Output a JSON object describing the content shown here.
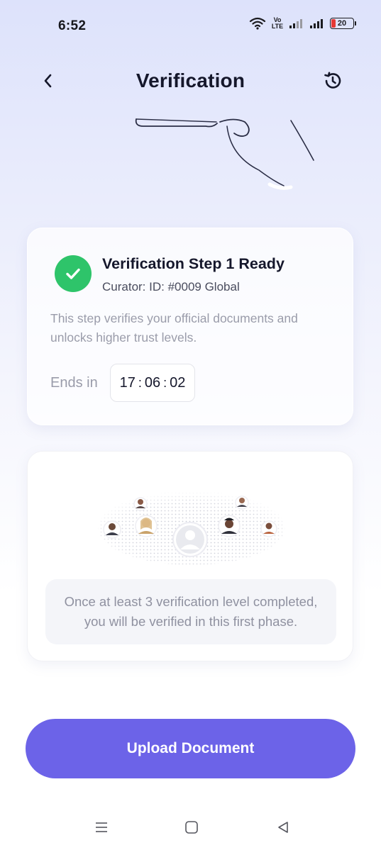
{
  "status_bar": {
    "time": "6:52",
    "network_label": "Vo LTE",
    "battery_level": "20",
    "battery_color": "#e53935"
  },
  "header": {
    "title": "Verification",
    "back_icon": "chevron-left-icon",
    "history_icon": "history-icon"
  },
  "verification_card": {
    "title": "Verification Step 1 Ready",
    "subtitle": "Curator: ID: #0009 Global",
    "description": "This step verifies your official documents and unlocks higher trust levels.",
    "ends_label": "Ends in",
    "timer": {
      "hours": "17",
      "minutes": "06",
      "seconds": "02",
      "separator": ":"
    },
    "status_icon": "check-icon",
    "status_color": "#2ec46a"
  },
  "info_card": {
    "illustration": "globe-avatars-icon",
    "message": "Once at least 3 verification level completed, you will be verified in this first phase."
  },
  "actions": {
    "upload_label": "Upload Document",
    "upload_color": "#6c63e8"
  },
  "nav": {
    "menu_icon": "menu-icon",
    "home_icon": "home-square-icon",
    "back_icon": "back-triangle-icon"
  }
}
